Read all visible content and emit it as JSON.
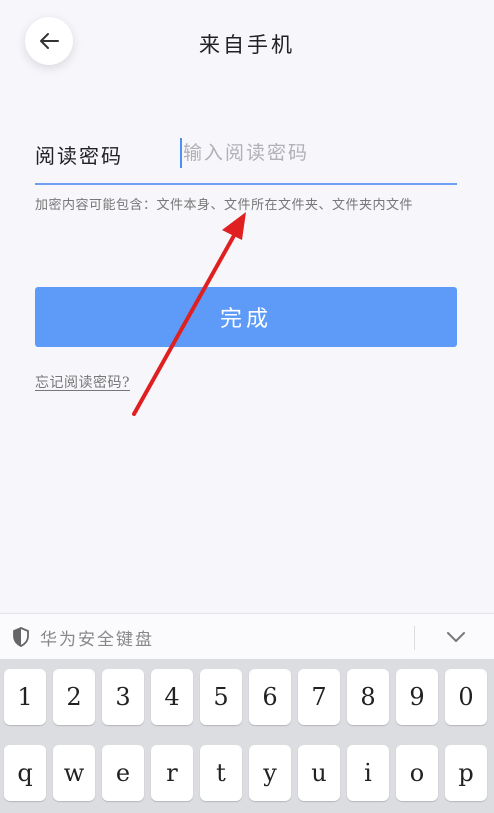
{
  "header": {
    "title": "来自手机",
    "back_icon": "arrow-left-icon"
  },
  "password": {
    "label": "阅读密码",
    "placeholder": "输入阅读密码",
    "value": "",
    "hint": "加密内容可能包含：文件本身、文件所在文件夹、文件夹内文件"
  },
  "done_button": {
    "label": "完成"
  },
  "forgot_link": {
    "label": "忘记阅读密码?"
  },
  "annotation": {
    "color": "#e02020"
  },
  "keyboard": {
    "title": "华为安全键盘",
    "shield_icon": "shield-icon",
    "collapse_icon": "chevron-down-icon",
    "rows": [
      [
        "1",
        "2",
        "3",
        "4",
        "5",
        "6",
        "7",
        "8",
        "9",
        "0"
      ],
      [
        "q",
        "w",
        "e",
        "r",
        "t",
        "y",
        "u",
        "i",
        "o",
        "p"
      ]
    ]
  },
  "colors": {
    "accent": "#5e9bf8",
    "underline": "#6d9ef2",
    "background": "#f6f6fb"
  }
}
